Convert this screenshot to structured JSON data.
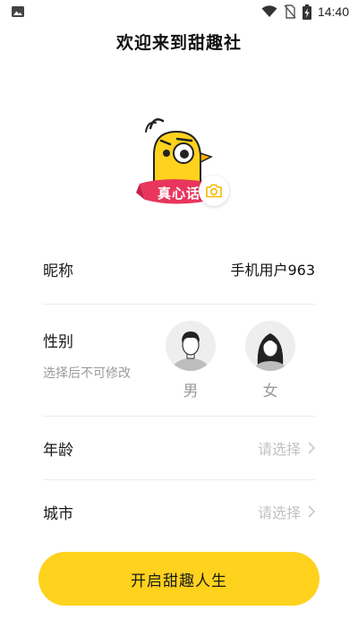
{
  "status_bar": {
    "time": "14:40",
    "icons": [
      "image-icon",
      "wifi-icon",
      "no-sim-icon",
      "battery-charging-icon"
    ]
  },
  "header": {
    "title": "欢迎来到甜趣社"
  },
  "avatar": {
    "badge_text": "真心话",
    "icon": "camera-icon"
  },
  "form": {
    "nickname": {
      "label": "昵称",
      "value": "手机用户963"
    },
    "gender": {
      "label": "性别",
      "hint": "选择后不可修改",
      "options": [
        {
          "label": "男",
          "icon": "male-avatar-icon"
        },
        {
          "label": "女",
          "icon": "female-avatar-icon"
        }
      ]
    },
    "age": {
      "label": "年龄",
      "placeholder": "请选择",
      "icon": "chevron-right-icon"
    },
    "city": {
      "label": "城市",
      "placeholder": "请选择",
      "icon": "chevron-right-icon"
    }
  },
  "submit": {
    "label": "开启甜趣人生"
  },
  "colors": {
    "accent_yellow": "#ffd21e",
    "badge_pink": "#e8365d",
    "divider": "#ececec",
    "hint_gray": "#9a9a9a",
    "placeholder_gray": "#c2c2c2"
  }
}
